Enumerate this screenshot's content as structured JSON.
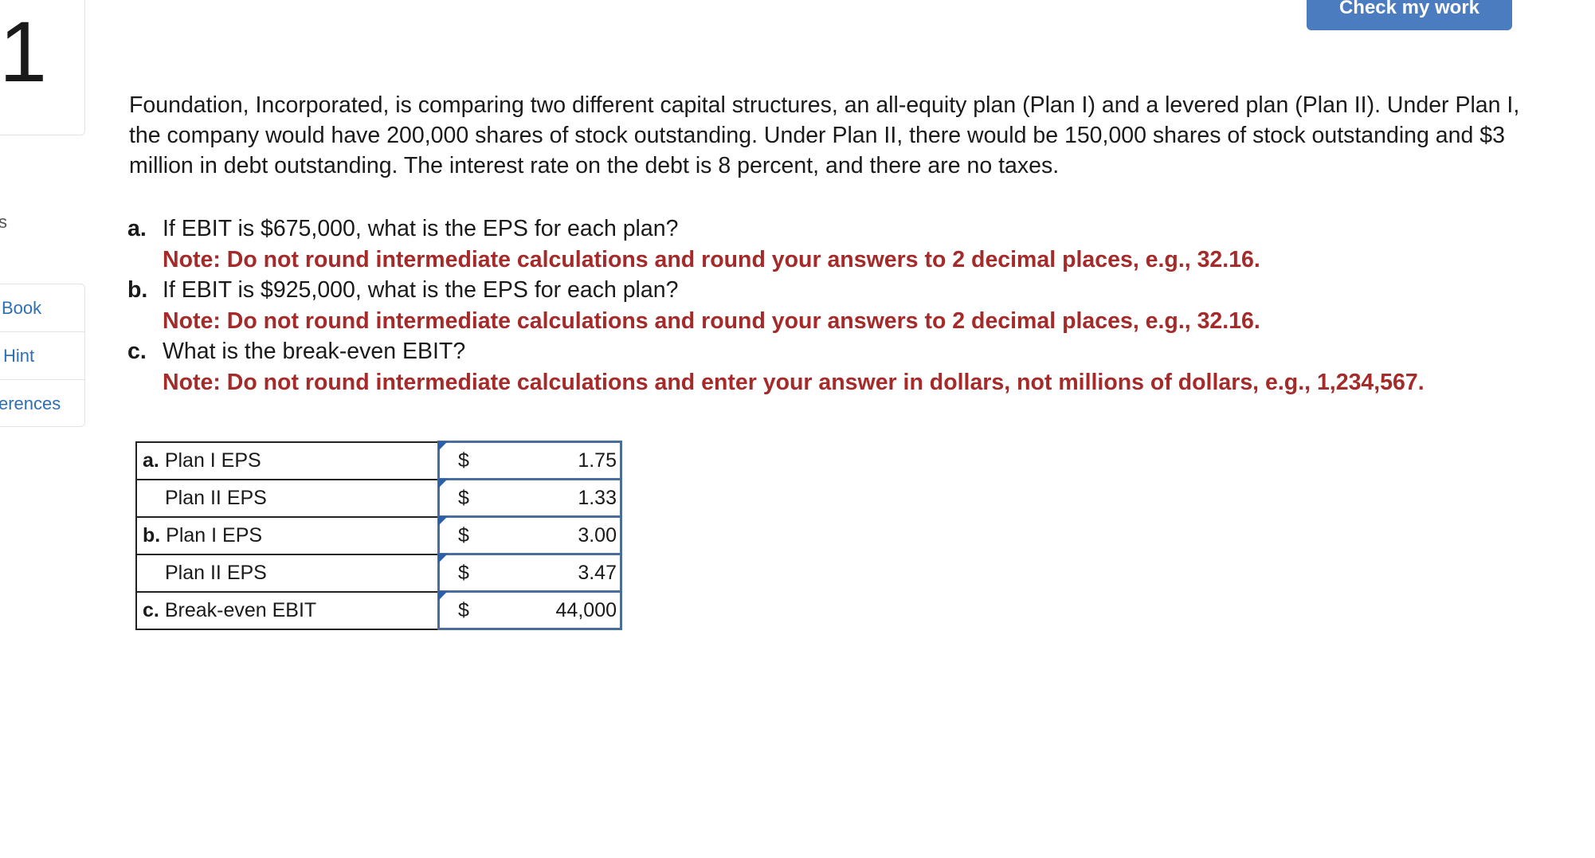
{
  "question_number": "1",
  "sidebar": {
    "partial_label": "s",
    "tools": [
      {
        "label": "Book"
      },
      {
        "label": "Hint"
      },
      {
        "label": "erences"
      }
    ]
  },
  "check_button": "Check my work",
  "question_text": "Foundation, Incorporated, is comparing two different capital structures, an all-equity plan (Plan I) and a levered plan (Plan II). Under Plan I, the company would have 200,000 shares of stock outstanding. Under Plan II, there would be 150,000 shares of stock outstanding and $3 million in debt outstanding. The interest rate on the debt is 8 percent, and there are no taxes.",
  "parts": [
    {
      "letter": "a.",
      "text": "If EBIT is $675,000, what is the EPS for each plan?",
      "note": "Note: Do not round intermediate calculations and round your answers to 2 decimal places, e.g., 32.16."
    },
    {
      "letter": "b.",
      "text": "If EBIT is $925,000, what is the EPS for each plan?",
      "note": "Note: Do not round intermediate calculations and round your answers to 2 decimal places, e.g., 32.16."
    },
    {
      "letter": "c.",
      "text": "What is the break-even EBIT?",
      "note": "Note: Do not round intermediate calculations and enter your answer in dollars, not millions of dollars, e.g., 1,234,567."
    }
  ],
  "answers": [
    {
      "letter": "a.",
      "label": "Plan I EPS",
      "currency": "$",
      "value": "1.75"
    },
    {
      "letter": "",
      "label": "Plan II EPS",
      "currency": "$",
      "value": "1.33"
    },
    {
      "letter": "b.",
      "label": "Plan I EPS",
      "currency": "$",
      "value": "3.00"
    },
    {
      "letter": "",
      "label": "Plan II EPS",
      "currency": "$",
      "value": "3.47"
    },
    {
      "letter": "c.",
      "label": "Break-even EBIT",
      "currency": "$",
      "value": "44,000"
    }
  ],
  "colors": {
    "accent": "#4a7cbf",
    "note": "#a52a2a",
    "link": "#2e6fb4"
  }
}
